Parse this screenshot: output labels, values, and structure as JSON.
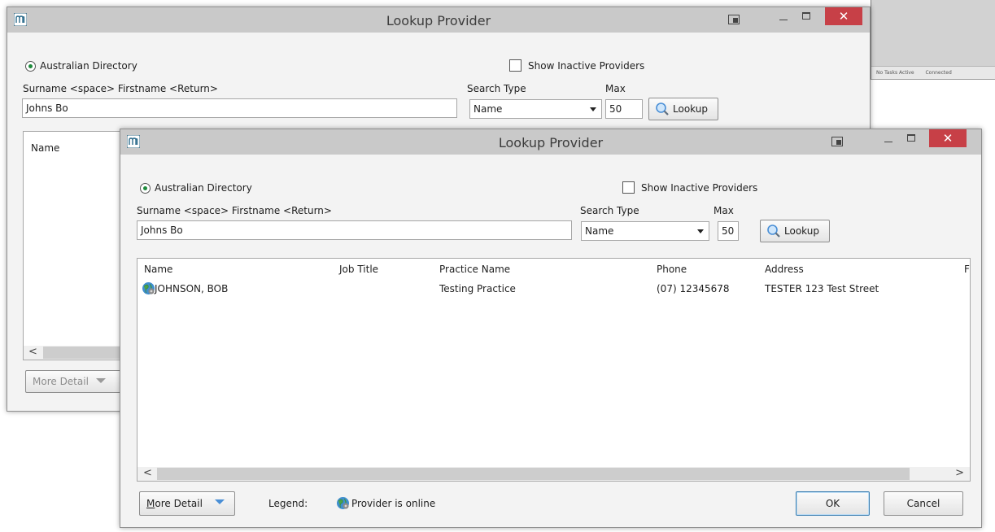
{
  "window_title": "Lookup Provider",
  "australian_directory_label": "Australian Directory",
  "show_inactive_label": "Show Inactive Providers",
  "surname_label": "Surname <space> Firstname <Return>",
  "search_value": "Johns Bo",
  "search_type_label": "Search Type",
  "search_type_value": "Name",
  "max_label": "Max",
  "max_value": "50",
  "lookup_label": "Lookup",
  "more_detail_label": "More Detail",
  "more_detail_accel": "M",
  "more_detail_rest": "ore Detail",
  "legend_label": "Legend:",
  "legend_text": "Provider is online",
  "ok_label": "OK",
  "cancel_label": "Cancel",
  "columns": {
    "name": "Name",
    "job_title": "Job Title",
    "practice_name": "Practice Name",
    "phone": "Phone",
    "address": "Address",
    "extra": "F"
  },
  "rows": [
    {
      "name": "JOHNSON, BOB",
      "job_title": "",
      "practice_name": "Testing Practice",
      "phone": "(07) 12345678",
      "address": "TESTER 123 Test Street"
    }
  ],
  "background_taskbar": {
    "item1": "No Tasks Active",
    "item2": "Connected"
  },
  "icons": {
    "app": "app-logo-icon",
    "online": "provider-online-icon",
    "lookup": "magnifier-icon"
  },
  "colors": {
    "titlebar": "#c9c9c9",
    "close": "#c74047",
    "accent": "#4a8fd6",
    "radio_dot": "#1e8a3c"
  }
}
